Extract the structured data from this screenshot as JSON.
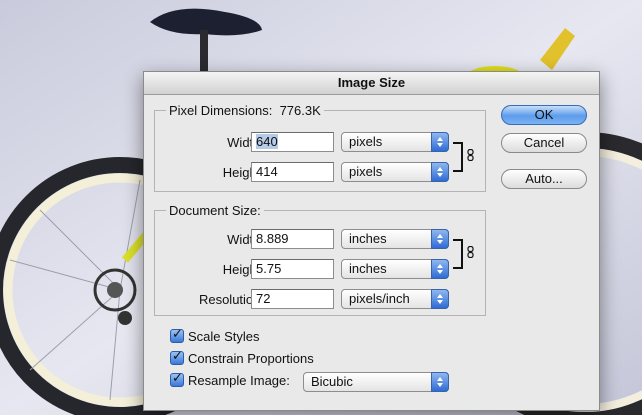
{
  "dialog": {
    "title": "Image Size"
  },
  "pixel_dimensions": {
    "title": "Pixel Dimensions:",
    "size": "776.3K",
    "width": {
      "label": "Width:",
      "value": "640",
      "unit": "pixels"
    },
    "height": {
      "label": "Height:",
      "value": "414",
      "unit": "pixels"
    }
  },
  "document_size": {
    "title": "Document Size:",
    "width": {
      "label": "Width:",
      "value": "8.889",
      "unit": "inches"
    },
    "height": {
      "label": "Height:",
      "value": "5.75",
      "unit": "inches"
    },
    "resolution": {
      "label": "Resolution:",
      "value": "72",
      "unit": "pixels/inch"
    }
  },
  "buttons": {
    "ok": "OK",
    "cancel": "Cancel",
    "auto": "Auto..."
  },
  "options": {
    "scale_styles": {
      "label": "Scale Styles",
      "checked": true
    },
    "constrain_proportions": {
      "label": "Constrain Proportions",
      "checked": true
    },
    "resample_image": {
      "label": "Resample Image:",
      "checked": true,
      "method": "Bicubic"
    }
  },
  "colors": {
    "accent": "#5c9ceb",
    "dialog_bg": "#e9e9e9"
  }
}
